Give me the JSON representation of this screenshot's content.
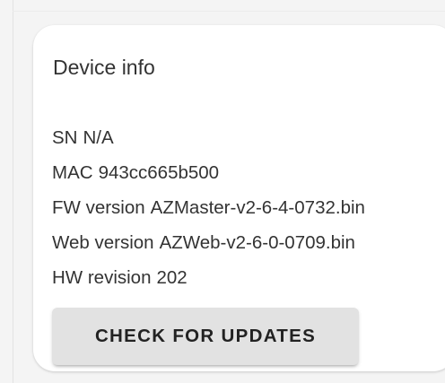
{
  "card": {
    "title": "Device info",
    "rows": [
      {
        "label": "SN",
        "value": "N/A"
      },
      {
        "label": "MAC",
        "value": "943cc665b500"
      },
      {
        "label": "FW version",
        "value": "AZMaster-v2-6-4-0732.bin"
      },
      {
        "label": "Web version",
        "value": "AZWeb-v2-6-0-0709.bin"
      },
      {
        "label": "HW revision",
        "value": "202"
      }
    ],
    "button_label": "CHECK FOR UPDATES"
  },
  "colors": {
    "background": "#f4f4f4",
    "card": "#ffffff",
    "text": "#333333",
    "button": "#e2e2e2"
  }
}
